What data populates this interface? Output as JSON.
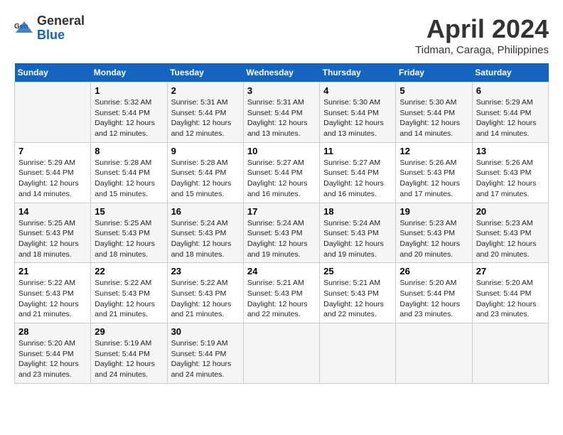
{
  "header": {
    "logo_general": "General",
    "logo_blue": "Blue",
    "month_title": "April 2024",
    "subtitle": "Tidman, Caraga, Philippines"
  },
  "days_of_week": [
    "Sunday",
    "Monday",
    "Tuesday",
    "Wednesday",
    "Thursday",
    "Friday",
    "Saturday"
  ],
  "weeks": [
    [
      {
        "day": "",
        "info": ""
      },
      {
        "day": "1",
        "info": "Sunrise: 5:32 AM\nSunset: 5:44 PM\nDaylight: 12 hours\nand 12 minutes."
      },
      {
        "day": "2",
        "info": "Sunrise: 5:31 AM\nSunset: 5:44 PM\nDaylight: 12 hours\nand 12 minutes."
      },
      {
        "day": "3",
        "info": "Sunrise: 5:31 AM\nSunset: 5:44 PM\nDaylight: 12 hours\nand 13 minutes."
      },
      {
        "day": "4",
        "info": "Sunrise: 5:30 AM\nSunset: 5:44 PM\nDaylight: 12 hours\nand 13 minutes."
      },
      {
        "day": "5",
        "info": "Sunrise: 5:30 AM\nSunset: 5:44 PM\nDaylight: 12 hours\nand 14 minutes."
      },
      {
        "day": "6",
        "info": "Sunrise: 5:29 AM\nSunset: 5:44 PM\nDaylight: 12 hours\nand 14 minutes."
      }
    ],
    [
      {
        "day": "7",
        "info": "Sunrise: 5:29 AM\nSunset: 5:44 PM\nDaylight: 12 hours\nand 14 minutes."
      },
      {
        "day": "8",
        "info": "Sunrise: 5:28 AM\nSunset: 5:44 PM\nDaylight: 12 hours\nand 15 minutes."
      },
      {
        "day": "9",
        "info": "Sunrise: 5:28 AM\nSunset: 5:44 PM\nDaylight: 12 hours\nand 15 minutes."
      },
      {
        "day": "10",
        "info": "Sunrise: 5:27 AM\nSunset: 5:44 PM\nDaylight: 12 hours\nand 16 minutes."
      },
      {
        "day": "11",
        "info": "Sunrise: 5:27 AM\nSunset: 5:44 PM\nDaylight: 12 hours\nand 16 minutes."
      },
      {
        "day": "12",
        "info": "Sunrise: 5:26 AM\nSunset: 5:43 PM\nDaylight: 12 hours\nand 17 minutes."
      },
      {
        "day": "13",
        "info": "Sunrise: 5:26 AM\nSunset: 5:43 PM\nDaylight: 12 hours\nand 17 minutes."
      }
    ],
    [
      {
        "day": "14",
        "info": "Sunrise: 5:25 AM\nSunset: 5:43 PM\nDaylight: 12 hours\nand 18 minutes."
      },
      {
        "day": "15",
        "info": "Sunrise: 5:25 AM\nSunset: 5:43 PM\nDaylight: 12 hours\nand 18 minutes."
      },
      {
        "day": "16",
        "info": "Sunrise: 5:24 AM\nSunset: 5:43 PM\nDaylight: 12 hours\nand 18 minutes."
      },
      {
        "day": "17",
        "info": "Sunrise: 5:24 AM\nSunset: 5:43 PM\nDaylight: 12 hours\nand 19 minutes."
      },
      {
        "day": "18",
        "info": "Sunrise: 5:24 AM\nSunset: 5:43 PM\nDaylight: 12 hours\nand 19 minutes."
      },
      {
        "day": "19",
        "info": "Sunrise: 5:23 AM\nSunset: 5:43 PM\nDaylight: 12 hours\nand 20 minutes."
      },
      {
        "day": "20",
        "info": "Sunrise: 5:23 AM\nSunset: 5:43 PM\nDaylight: 12 hours\nand 20 minutes."
      }
    ],
    [
      {
        "day": "21",
        "info": "Sunrise: 5:22 AM\nSunset: 5:43 PM\nDaylight: 12 hours\nand 21 minutes."
      },
      {
        "day": "22",
        "info": "Sunrise: 5:22 AM\nSunset: 5:43 PM\nDaylight: 12 hours\nand 21 minutes."
      },
      {
        "day": "23",
        "info": "Sunrise: 5:22 AM\nSunset: 5:43 PM\nDaylight: 12 hours\nand 21 minutes."
      },
      {
        "day": "24",
        "info": "Sunrise: 5:21 AM\nSunset: 5:43 PM\nDaylight: 12 hours\nand 22 minutes."
      },
      {
        "day": "25",
        "info": "Sunrise: 5:21 AM\nSunset: 5:43 PM\nDaylight: 12 hours\nand 22 minutes."
      },
      {
        "day": "26",
        "info": "Sunrise: 5:20 AM\nSunset: 5:44 PM\nDaylight: 12 hours\nand 23 minutes."
      },
      {
        "day": "27",
        "info": "Sunrise: 5:20 AM\nSunset: 5:44 PM\nDaylight: 12 hours\nand 23 minutes."
      }
    ],
    [
      {
        "day": "28",
        "info": "Sunrise: 5:20 AM\nSunset: 5:44 PM\nDaylight: 12 hours\nand 23 minutes."
      },
      {
        "day": "29",
        "info": "Sunrise: 5:19 AM\nSunset: 5:44 PM\nDaylight: 12 hours\nand 24 minutes."
      },
      {
        "day": "30",
        "info": "Sunrise: 5:19 AM\nSunset: 5:44 PM\nDaylight: 12 hours\nand 24 minutes."
      },
      {
        "day": "",
        "info": ""
      },
      {
        "day": "",
        "info": ""
      },
      {
        "day": "",
        "info": ""
      },
      {
        "day": "",
        "info": ""
      }
    ]
  ]
}
